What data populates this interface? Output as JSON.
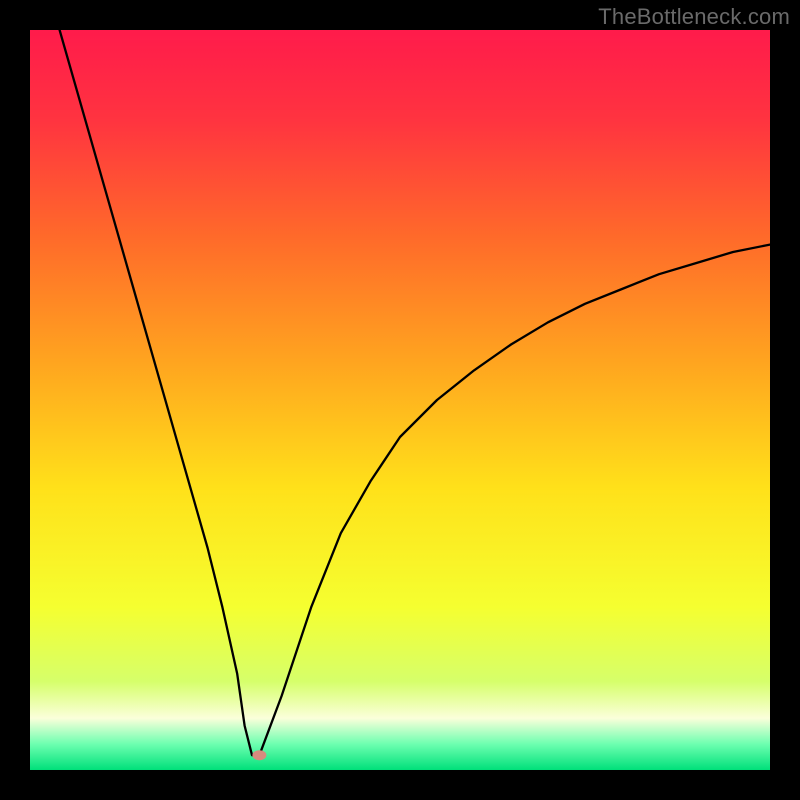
{
  "watermark": "TheBottleneck.com",
  "chart_data": {
    "type": "line",
    "title": "",
    "xlabel": "",
    "ylabel": "",
    "xlim": [
      0,
      100
    ],
    "ylim": [
      0,
      100
    ],
    "gradient": {
      "stops": [
        {
          "offset": 0.0,
          "color": "#ff1b4b"
        },
        {
          "offset": 0.12,
          "color": "#ff3340"
        },
        {
          "offset": 0.28,
          "color": "#ff6a2a"
        },
        {
          "offset": 0.45,
          "color": "#ffa51f"
        },
        {
          "offset": 0.62,
          "color": "#ffe11a"
        },
        {
          "offset": 0.78,
          "color": "#f5ff30"
        },
        {
          "offset": 0.88,
          "color": "#d6ff6a"
        },
        {
          "offset": 0.93,
          "color": "#fbffda"
        },
        {
          "offset": 0.965,
          "color": "#6dffb0"
        },
        {
          "offset": 1.0,
          "color": "#00e07a"
        }
      ]
    },
    "curve": {
      "x": [
        4,
        6,
        8,
        10,
        12,
        14,
        16,
        18,
        20,
        22,
        24,
        26,
        28,
        29,
        30,
        31,
        34,
        38,
        42,
        46,
        50,
        55,
        60,
        65,
        70,
        75,
        80,
        85,
        90,
        95,
        100
      ],
      "y": [
        100,
        93,
        86,
        79,
        72,
        65,
        58,
        51,
        44,
        37,
        30,
        22,
        13,
        6,
        2,
        2,
        10,
        22,
        32,
        39,
        45,
        50,
        54,
        57.5,
        60.5,
        63,
        65,
        67,
        68.5,
        70,
        71
      ]
    },
    "valley_flat": {
      "x": [
        28.5,
        31
      ],
      "y": 2
    },
    "marker": {
      "x": 31,
      "y": 2,
      "color": "#d68b7e",
      "rx": 7,
      "ry": 5
    }
  }
}
